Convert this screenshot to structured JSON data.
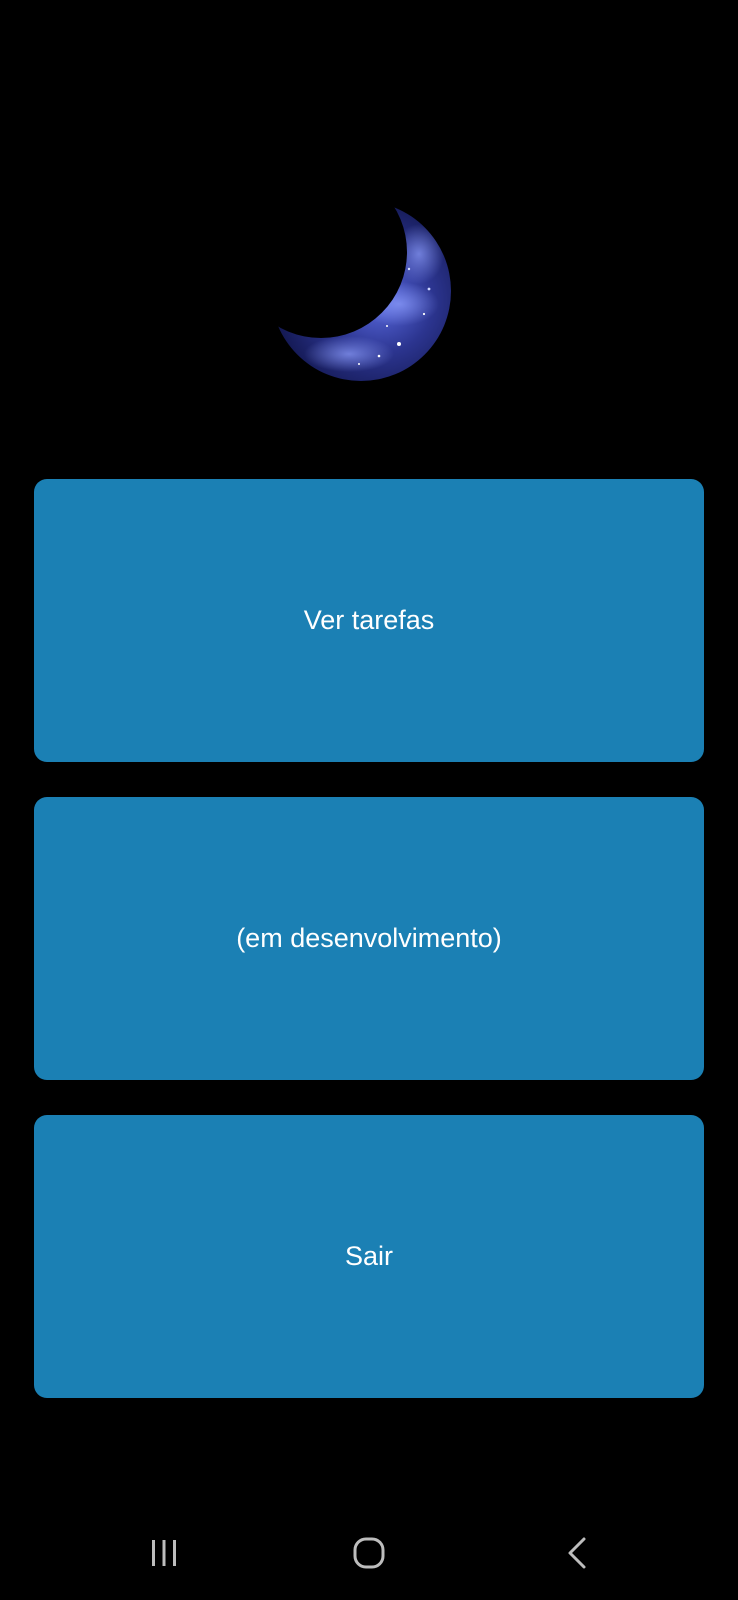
{
  "colors": {
    "background": "#000000",
    "button": "#1b80b4",
    "button_text": "#ffffff",
    "nav_icon": "#bdbdbd"
  },
  "logo": {
    "icon": "crescent-moon-icon"
  },
  "menu": {
    "buttons": [
      {
        "label": "Ver tarefas"
      },
      {
        "label": "(em desenvolvimento)"
      },
      {
        "label": "Sair"
      }
    ]
  },
  "navbar": {
    "icons": [
      "recent-apps-icon",
      "home-icon",
      "back-icon"
    ]
  }
}
